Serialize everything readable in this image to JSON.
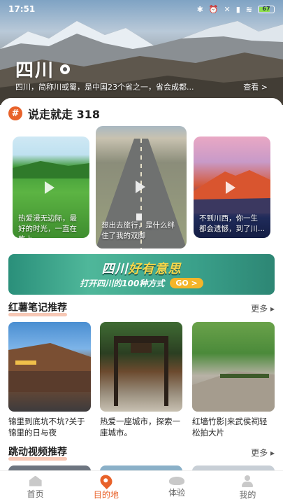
{
  "status_bar": {
    "time": "17:51",
    "icons": [
      "bluetooth-icon",
      "alarm-icon",
      "mute-icon",
      "signal-icon",
      "wifi-icon"
    ],
    "battery": "67"
  },
  "hero": {
    "title": "四川",
    "description": "四川，简称川或蜀，是中国23个省之一，省会成都...",
    "more": "查看 >"
  },
  "section_318": {
    "badge": "#",
    "title": "说走就走 318"
  },
  "videos": [
    {
      "caption": "热爱漫无边际，最好的时光，一直在路上"
    },
    {
      "caption": "想出去旅行，是什么绊住了我的双脚"
    },
    {
      "caption": "不到川西，你一生都会遗憾，到了川..."
    }
  ],
  "banner": {
    "title_a": "四川",
    "title_b": "好有意思",
    "subtitle": "打开四川的100种方式",
    "go": "GO >"
  },
  "notes_section": {
    "title": "红薯笔记推荐",
    "more": "更多 ▸"
  },
  "notes": [
    {
      "title": "锦里到底坑不坑?关于锦里的日与夜"
    },
    {
      "title": "热爱一座城市，探索一座城市。"
    },
    {
      "title": "红墙竹影|来武侯祠轻松拍大片"
    }
  ],
  "video_section": {
    "title": "跳动视频推荐",
    "more": "更多 ▸"
  },
  "nav": [
    {
      "label": "首页",
      "icon": "home-icon"
    },
    {
      "label": "目的地",
      "icon": "location-pin-icon",
      "active": true
    },
    {
      "label": "体验",
      "icon": "experience-icon"
    },
    {
      "label": "我的",
      "icon": "user-icon"
    }
  ],
  "colors": {
    "accent": "#e8622a",
    "banner": "#3aa08a",
    "banner_text": "#f7d64a"
  }
}
